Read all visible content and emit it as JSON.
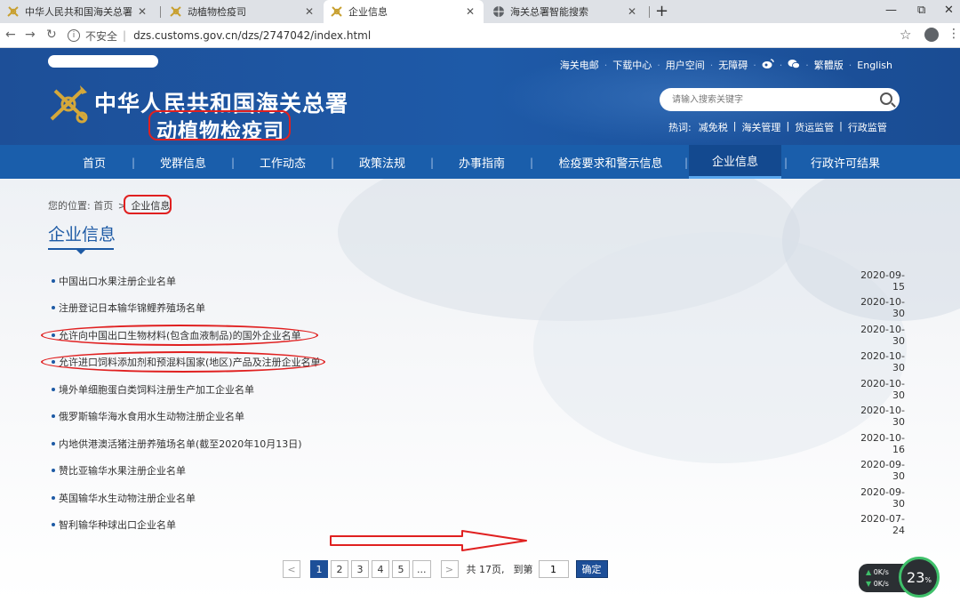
{
  "browser": {
    "tabs": [
      {
        "title": "中华人民共和国海关总署",
        "favicon": "customs-emblem-icon",
        "active": false
      },
      {
        "title": "动植物检疫司",
        "favicon": "customs-emblem-icon",
        "active": false
      },
      {
        "title": "企业信息",
        "favicon": "customs-emblem-icon",
        "active": true
      },
      {
        "title": "海关总署智能搜索",
        "favicon": "globe-icon",
        "active": false
      }
    ],
    "new_tab": "+",
    "security_label": "不安全",
    "url": "dzs.customs.gov.cn/dzs/2747042/index.html",
    "window_controls": {
      "minimize": "—",
      "restore": "⧉",
      "close": "✕"
    }
  },
  "header": {
    "site_title": "中华人民共和国海关总署",
    "dept_title": "动植物检疫司",
    "top_links": [
      "海关电邮",
      "下载中心",
      "用户空间",
      "无障碍"
    ],
    "social_icons": [
      "weibo-icon",
      "wechat-icon"
    ],
    "lang_links": [
      "繁體版",
      "English"
    ],
    "search_placeholder": "请输入搜索关键字",
    "hot_label": "热词:",
    "hot_words": [
      "减免税",
      "海关管理",
      "货运监管",
      "行政监管"
    ]
  },
  "nav": {
    "items": [
      "首页",
      "党群信息",
      "工作动态",
      "政策法规",
      "办事指南",
      "检疫要求和警示信息",
      "企业信息",
      "行政许可结果"
    ],
    "active_index": 6
  },
  "breadcrumb": {
    "prefix": "您的位置:",
    "home": "首页",
    "sep": ">",
    "current": "企业信息"
  },
  "page_title": "企业信息",
  "list": [
    {
      "title": "中国出口水果注册企业名单",
      "date": "2020-09-15",
      "circled": false
    },
    {
      "title": "注册登记日本输华锦鲤养殖场名单",
      "date": "2020-10-30",
      "circled": false
    },
    {
      "title": "允许向中国出口生物材料(包含血液制品)的国外企业名单",
      "date": "2020-10-30",
      "circled": true
    },
    {
      "title": "允许进口饲料添加剂和预混料国家(地区)产品及注册企业名单",
      "date": "2020-10-30",
      "circled": true
    },
    {
      "title": "境外单细胞蛋白类饲料注册生产加工企业名单",
      "date": "2020-10-30",
      "circled": false
    },
    {
      "title": "俄罗斯输华海水食用水生动物注册企业名单",
      "date": "2020-10-30",
      "circled": false
    },
    {
      "title": "内地供港澳活猪注册养殖场名单(截至2020年10月13日)",
      "date": "2020-10-16",
      "circled": false
    },
    {
      "title": "赞比亚输华水果注册企业名单",
      "date": "2020-09-30",
      "circled": false
    },
    {
      "title": "英国输华水生动物注册企业名单",
      "date": "2020-09-30",
      "circled": false
    },
    {
      "title": "智利输华种球出口企业名单",
      "date": "2020-07-24",
      "circled": false
    }
  ],
  "pager": {
    "prev": "<",
    "pages": [
      "1",
      "2",
      "3",
      "4",
      "5",
      "..."
    ],
    "current": "1",
    "next": ">",
    "total_label": "共 17页,",
    "goto_label": "到第",
    "goto_value": "1",
    "confirm": "确定"
  },
  "speed_widget": {
    "up": "0K/s",
    "down": "0K/s",
    "percent": "23",
    "percent_unit": "%"
  },
  "annotation_color": "#e02020"
}
